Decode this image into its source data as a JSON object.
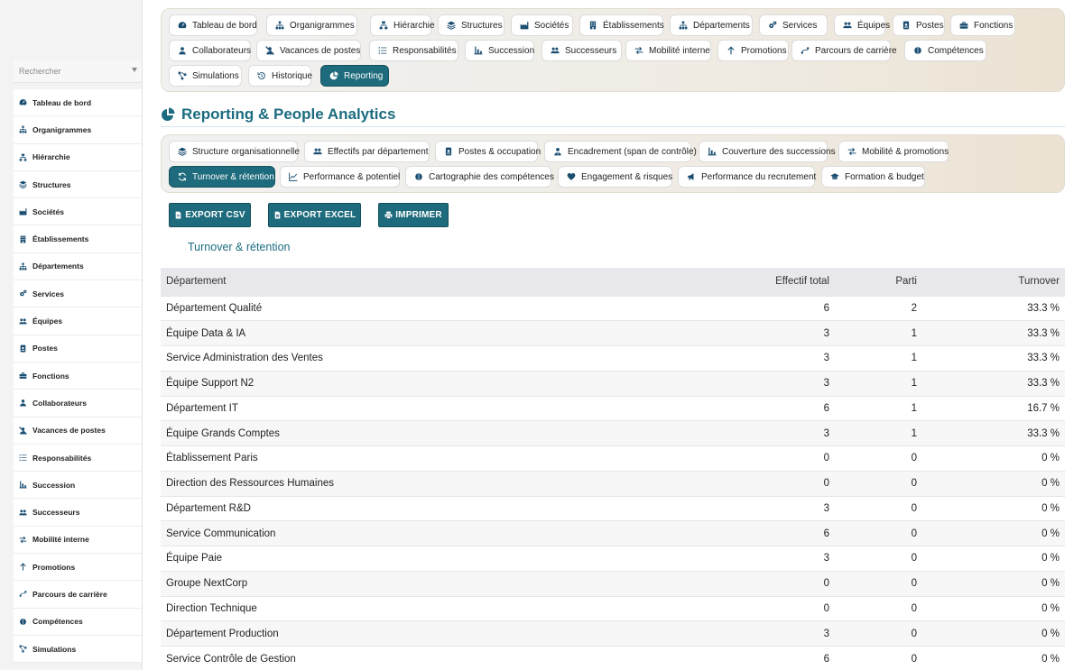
{
  "sidebar": {
    "search_placeholder": "Rechercher",
    "items": [
      {
        "label": "Tableau de bord",
        "icon": "dashboard-icon"
      },
      {
        "label": "Organigrammes",
        "icon": "sitemap-icon"
      },
      {
        "label": "Hiérarchie",
        "icon": "hierarchy-icon"
      },
      {
        "label": "Structures",
        "icon": "layers-icon"
      },
      {
        "label": "Sociétés",
        "icon": "industry-icon"
      },
      {
        "label": "Établissements",
        "icon": "building-icon"
      },
      {
        "label": "Départements",
        "icon": "sitemap-icon"
      },
      {
        "label": "Services",
        "icon": "cogs-icon"
      },
      {
        "label": "Équipes",
        "icon": "users-icon"
      },
      {
        "label": "Postes",
        "icon": "id-badge-icon"
      },
      {
        "label": "Fonctions",
        "icon": "briefcase-icon"
      },
      {
        "label": "Collaborateurs",
        "icon": "user-icon"
      },
      {
        "label": "Vacances de postes",
        "icon": "user-slash-icon"
      },
      {
        "label": "Responsabilités",
        "icon": "list-icon"
      },
      {
        "label": "Succession",
        "icon": "chart-succession-icon"
      },
      {
        "label": "Successeurs",
        "icon": "users-icon"
      },
      {
        "label": "Mobilité interne",
        "icon": "exchange-icon"
      },
      {
        "label": "Promotions",
        "icon": "arrow-up-icon"
      },
      {
        "label": "Parcours de carrière",
        "icon": "route-icon"
      },
      {
        "label": "Compétences",
        "icon": "brain-icon"
      },
      {
        "label": "Simulations",
        "icon": "project-diagram-icon"
      }
    ]
  },
  "modules": [
    {
      "label": "Tableau de bord",
      "icon": "dashboard-icon",
      "active": false
    },
    {
      "label": "Organigrammes",
      "icon": "sitemap-icon",
      "active": false
    },
    {
      "label": "Hiérarchie",
      "icon": "hierarchy-icon",
      "active": false
    },
    {
      "label": "Structures",
      "icon": "layers-icon",
      "active": false
    },
    {
      "label": "Sociétés",
      "icon": "industry-icon",
      "active": false
    },
    {
      "label": "Établissements",
      "icon": "building-icon",
      "active": false
    },
    {
      "label": "Départements",
      "icon": "sitemap-icon",
      "active": false
    },
    {
      "label": "Services",
      "icon": "cogs-icon",
      "active": false
    },
    {
      "label": "Équipes",
      "icon": "users-icon",
      "active": false
    },
    {
      "label": "Postes",
      "icon": "id-badge-icon",
      "active": false
    },
    {
      "label": "Fonctions",
      "icon": "briefcase-icon",
      "active": false
    },
    {
      "label": "Collaborateurs",
      "icon": "user-icon",
      "active": false
    },
    {
      "label": "Vacances de postes",
      "icon": "user-slash-icon",
      "active": false
    },
    {
      "label": "Responsabilités",
      "icon": "list-icon",
      "active": false
    },
    {
      "label": "Succession",
      "icon": "chart-succession-icon",
      "active": false
    },
    {
      "label": "Successeurs",
      "icon": "users-icon",
      "active": false
    },
    {
      "label": "Mobilité interne",
      "icon": "exchange-icon",
      "active": false
    },
    {
      "label": "Promotions",
      "icon": "arrow-up-icon",
      "active": false
    },
    {
      "label": "Parcours de carrière",
      "icon": "route-icon",
      "active": false
    },
    {
      "label": "Compétences",
      "icon": "brain-icon",
      "active": false
    },
    {
      "label": "Simulations",
      "icon": "project-diagram-icon",
      "active": false
    },
    {
      "label": "Historique",
      "icon": "history-icon",
      "active": false
    },
    {
      "label": "Reporting",
      "icon": "pie-chart-icon",
      "active": true
    }
  ],
  "page": {
    "title": "Reporting & People Analytics",
    "title_icon": "pie-chart-icon",
    "subtitle": "Turnover & rétention"
  },
  "reports": [
    {
      "label": "Structure organisationnelle",
      "icon": "layers-icon",
      "active": false
    },
    {
      "label": "Effectifs par département",
      "icon": "users-icon",
      "active": false
    },
    {
      "label": "Postes & occupation",
      "icon": "id-badge-icon",
      "active": false
    },
    {
      "label": "Encadrement (span de contrôle)",
      "icon": "user-tie-icon",
      "active": false
    },
    {
      "label": "Couverture des successions",
      "icon": "chart-succession-icon",
      "active": false
    },
    {
      "label": "Mobilité & promotions",
      "icon": "exchange-icon",
      "active": false
    },
    {
      "label": "Turnover & rétention",
      "icon": "sync-icon",
      "active": true
    },
    {
      "label": "Performance & potentiel",
      "icon": "line-chart-icon",
      "active": false
    },
    {
      "label": "Cartographie des compétences",
      "icon": "brain-icon",
      "active": false
    },
    {
      "label": "Engagement & risques",
      "icon": "heart-icon",
      "active": false
    },
    {
      "label": "Performance du recrutement",
      "icon": "bullhorn-icon",
      "active": false
    },
    {
      "label": "Formation & budget",
      "icon": "graduation-cap-icon",
      "active": false
    }
  ],
  "actions": {
    "export_csv": "EXPORT CSV",
    "export_excel": "EXPORT EXCEL",
    "print": "IMPRIMER"
  },
  "table": {
    "headers": [
      "Département",
      "Effectif total",
      "Parti",
      "Turnover"
    ],
    "rows": [
      [
        "Département Qualité",
        "6",
        "2",
        "33.3 %"
      ],
      [
        "Équipe Data & IA",
        "3",
        "1",
        "33.3 %"
      ],
      [
        "Service Administration des Ventes",
        "3",
        "1",
        "33.3 %"
      ],
      [
        "Équipe Support N2",
        "3",
        "1",
        "33.3 %"
      ],
      [
        "Département IT",
        "6",
        "1",
        "16.7 %"
      ],
      [
        "Équipe Grands Comptes",
        "3",
        "1",
        "33.3 %"
      ],
      [
        "Établissement Paris",
        "0",
        "0",
        "0 %"
      ],
      [
        "Direction des Ressources Humaines",
        "0",
        "0",
        "0 %"
      ],
      [
        "Département R&D",
        "3",
        "0",
        "0 %"
      ],
      [
        "Service Communication",
        "6",
        "0",
        "0 %"
      ],
      [
        "Équipe Paie",
        "3",
        "0",
        "0 %"
      ],
      [
        "Groupe NextCorp",
        "0",
        "0",
        "0 %"
      ],
      [
        "Direction Technique",
        "0",
        "0",
        "0 %"
      ],
      [
        "Département Production",
        "3",
        "0",
        "0 %"
      ],
      [
        "Service Contrôle de Gestion",
        "6",
        "0",
        "0 %"
      ]
    ]
  },
  "colors": {
    "accent": "#1d6b7c",
    "title": "#1b6c80",
    "icon": "#1b4f72"
  }
}
